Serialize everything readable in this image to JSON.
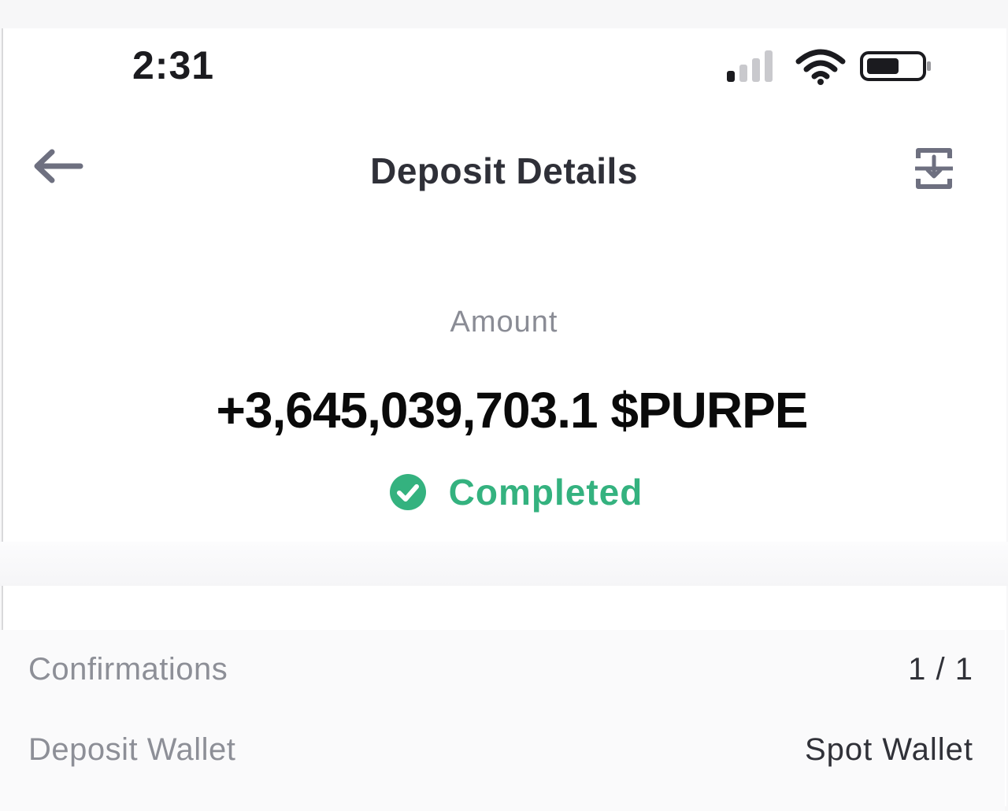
{
  "status_bar": {
    "time": "2:31",
    "icons": [
      "signal-icon",
      "wifi-icon",
      "battery-icon"
    ]
  },
  "header": {
    "title": "Deposit Details",
    "back_icon": "back-arrow-icon",
    "export_icon": "export-icon"
  },
  "amount": {
    "label": "Amount",
    "value": "+3,645,039,703.1 $PURPE"
  },
  "status": {
    "text": "Completed",
    "icon": "check-circle-icon",
    "color": "#34b27f"
  },
  "details": [
    {
      "label": "Confirmations",
      "value": "1 / 1"
    },
    {
      "label": "Deposit Wallet",
      "value": "Spot Wallet"
    }
  ],
  "colors": {
    "accent_green": "#34b27f",
    "text_primary": "#2f3038",
    "text_secondary": "#8d8f97"
  }
}
